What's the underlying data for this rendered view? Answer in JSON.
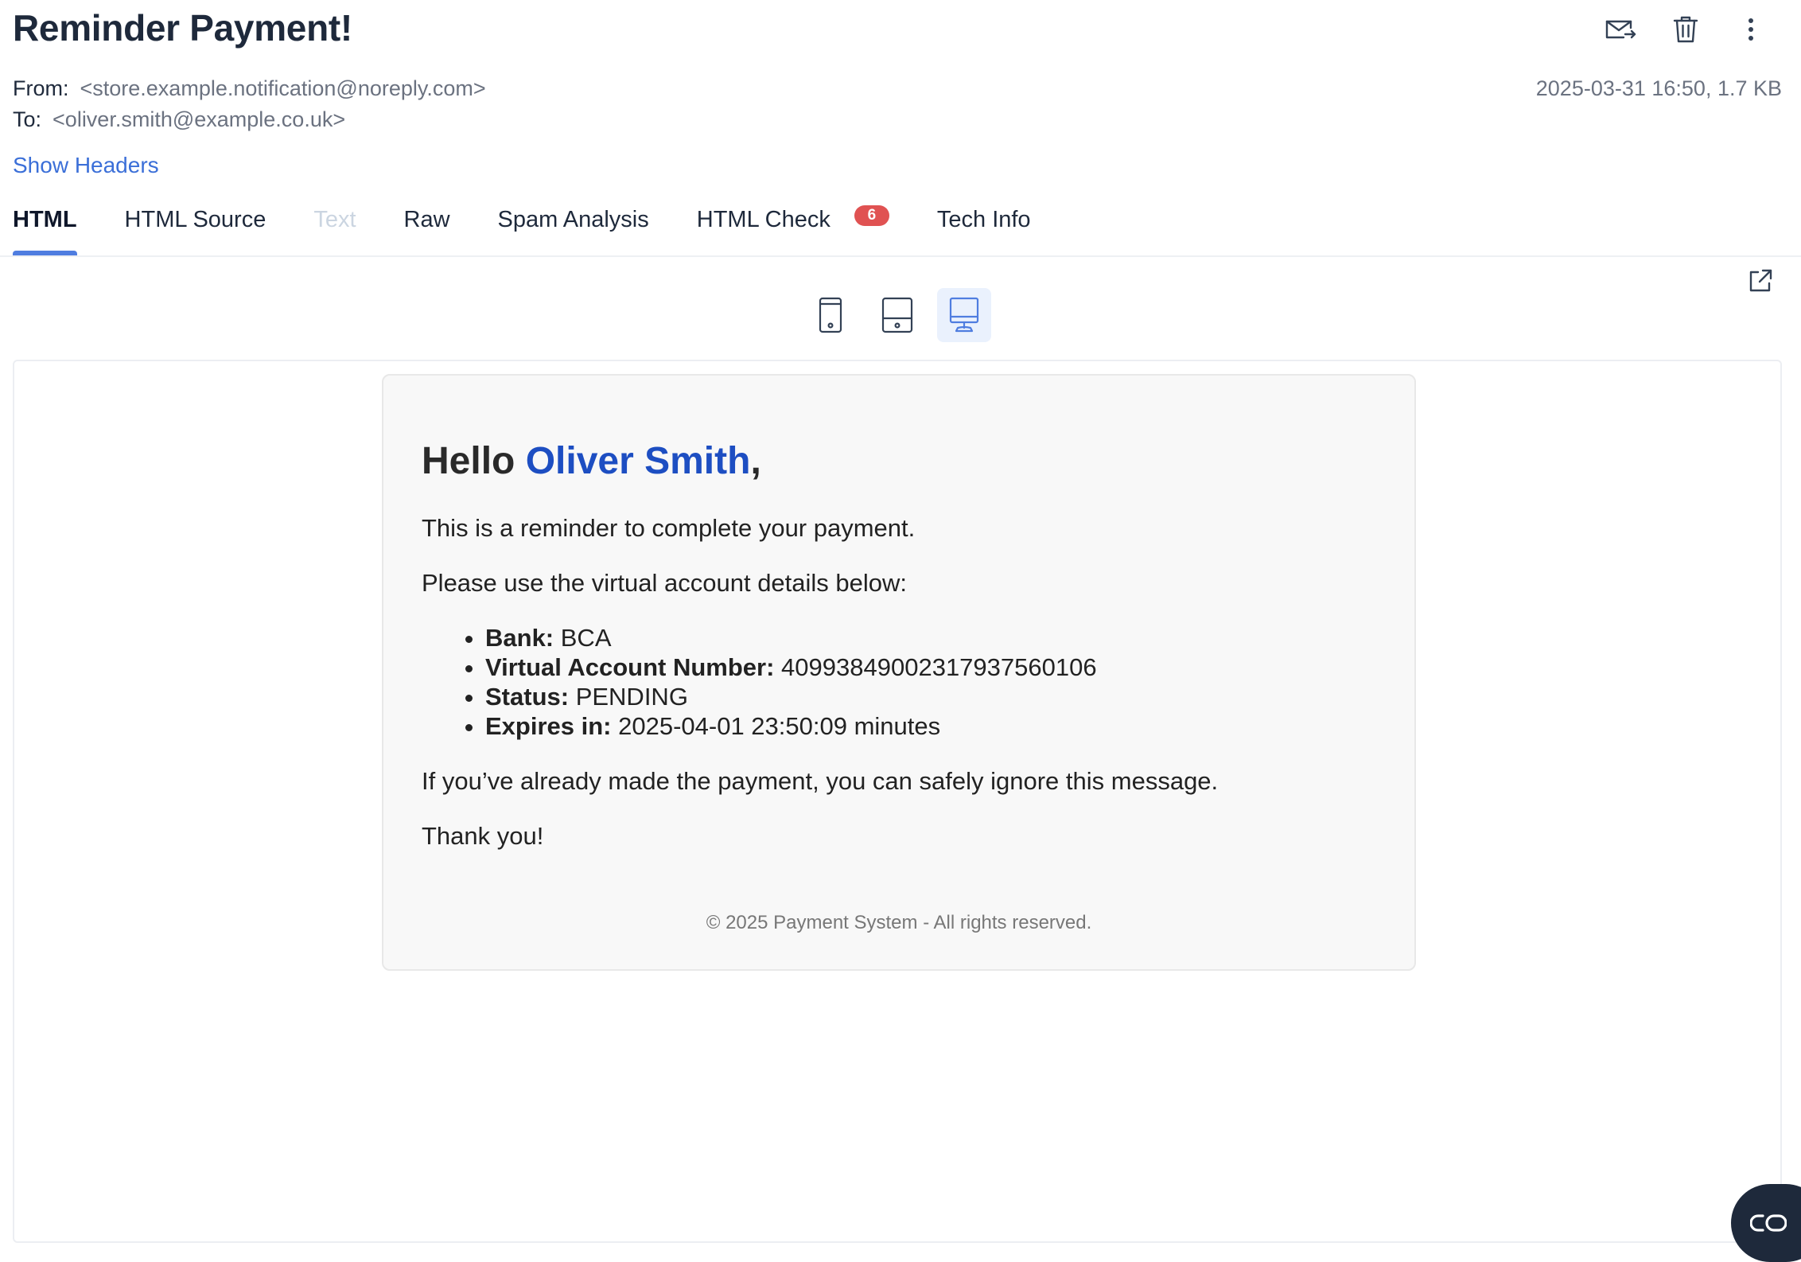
{
  "email": {
    "subject": "Reminder Payment!",
    "from_label": "From:",
    "from_value": "<store.example.notification@noreply.com>",
    "to_label": "To:",
    "to_value": "<oliver.smith@example.co.uk>",
    "date_size": "2025-03-31 16:50, 1.7 KB",
    "show_headers": "Show Headers"
  },
  "tabs": [
    {
      "label": "HTML"
    },
    {
      "label": "HTML Source"
    },
    {
      "label": "Text"
    },
    {
      "label": "Raw"
    },
    {
      "label": "Spam Analysis"
    },
    {
      "label": "HTML Check",
      "badge": "6"
    },
    {
      "label": "Tech Info"
    }
  ],
  "icons": {
    "forward": "forward-mail-icon",
    "delete": "trash-icon",
    "more": "more-vertical-icon",
    "popout": "external-link-icon",
    "mobile": "mobile-device-icon",
    "tablet": "tablet-device-icon",
    "desktop": "desktop-device-icon",
    "chat": "chat-icon"
  },
  "colors": {
    "accent": "#4f7de0",
    "link": "#3b6fd8",
    "badge": "#e05252",
    "name_highlight": "#1d4ec2"
  },
  "message": {
    "greeting_prefix": "Hello ",
    "greeting_name": "Oliver Smith",
    "greeting_suffix": ",",
    "line1": "This is a reminder to complete your payment.",
    "line2": "Please use the virtual account details below:",
    "details": [
      {
        "label": "Bank:",
        "value": " BCA"
      },
      {
        "label": "Virtual Account Number:",
        "value": " 40993849002317937560106"
      },
      {
        "label": "Status:",
        "value": " PENDING"
      },
      {
        "label": "Expires in:",
        "value": " 2025-04-01 23:50:09 minutes"
      }
    ],
    "line3": "If you’ve already made the payment, you can safely ignore this message.",
    "line4": "Thank you!",
    "footer": "© 2025 Payment System - All rights reserved."
  }
}
